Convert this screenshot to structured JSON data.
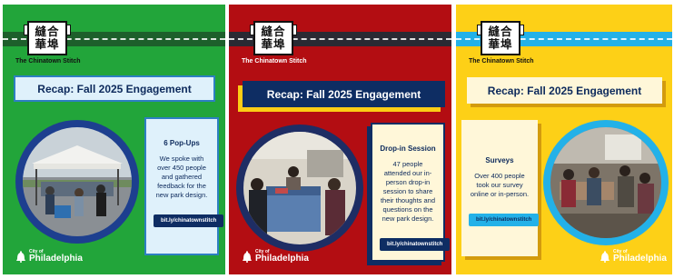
{
  "colors": {
    "green_panel": "#22a53a",
    "red_panel": "#b30d12",
    "yellow_panel": "#fdd017",
    "navy": "#0e2d63",
    "light_blue": "#dff1fb",
    "sky_blue": "#23b1e8"
  },
  "panels": [
    {
      "logo": "縫合\n華埠",
      "brand": "The Chinatown Stitch",
      "title": "Recap: Fall 2025 Engagement",
      "card_title": "6 Pop-Ups",
      "card_text": "We spoke with over 450 people and gathered feedback for the new park design.",
      "link": "bit.ly/chinatownstitch",
      "city_small": "City of",
      "city_big": "Philadelphia"
    },
    {
      "logo": "縫合\n華埠",
      "brand": "The Chinatown Stitch",
      "title": "Recap: Fall 2025 Engagement",
      "card_title": "Drop-in Session",
      "card_text": "47 people attended our in-person drop-in session to share their thoughts and questions on the new park design.",
      "link": "bit.ly/chinatownstitch",
      "city_small": "City of",
      "city_big": "Philadelphia"
    },
    {
      "logo": "縫合\n華埠",
      "brand": "The Chinatown Stitch",
      "title": "Recap: Fall 2025 Engagement",
      "card_title": "Surveys",
      "card_text": "Over 400 people took our survey online or in-person.",
      "link": "bit.ly/chinatownstitch",
      "city_small": "City of",
      "city_big": "Philadelphia"
    }
  ]
}
